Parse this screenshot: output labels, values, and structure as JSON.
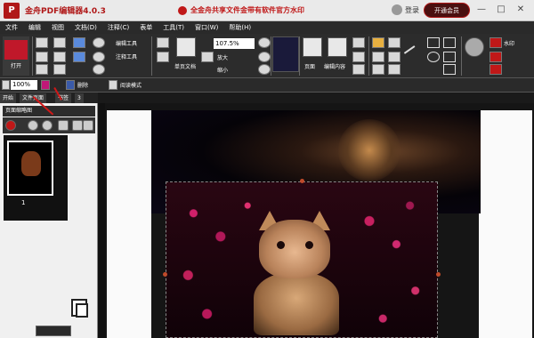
{
  "app": {
    "logo": "P",
    "title": "金舟PDF编辑器4.0.3",
    "promo": "全金舟共享文件金带有软件官方水印",
    "login": "登录",
    "upgrade": "开通会员",
    "win_min": "—",
    "win_max": "□",
    "win_close": "✕"
  },
  "menu": [
    "文件",
    "编辑",
    "视图",
    "文档(D)",
    "注释(C)",
    "表单",
    "工具(T)",
    "窗口(W)",
    "帮助(H)"
  ],
  "ribbon": {
    "open_label": "打开",
    "edit_text": "编辑工具",
    "comment_tool": "注释工具",
    "single_page": "单页文档",
    "zoom_value": "107.5%",
    "enlarge": "放大",
    "shrink": "缩小",
    "pages": "页面",
    "print": "打印",
    "edit_content": "编辑内容",
    "watermark": "水印"
  },
  "toolbar2": {
    "zoom": "100%",
    "label_a": "删除",
    "label_b": "阅读模式"
  },
  "tabs": [
    "开始",
    "文件页面",
    "书签",
    "3"
  ],
  "left_panel": {
    "title": "页面缩略图",
    "page_number": "1"
  },
  "colors": {
    "brand_red": "#b01818",
    "ribbon_bg": "#2c2c2c",
    "panel_bg": "#f0f0f0"
  },
  "icons": [
    "search-icon",
    "undo-icon",
    "redo-icon",
    "print-icon",
    "zoom-in-icon",
    "zoom-out-icon",
    "copy-pages-icon"
  ]
}
